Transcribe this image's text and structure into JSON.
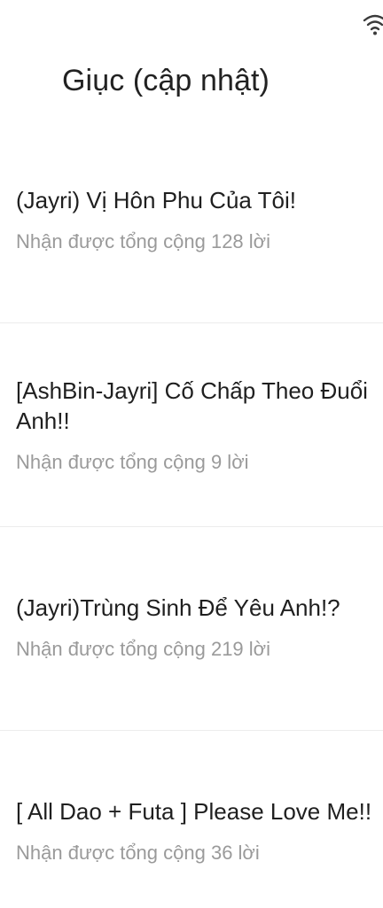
{
  "status_bar": {
    "icons": [
      "wifi-icon"
    ]
  },
  "header": {
    "title": "Giục (cập nhật)"
  },
  "items": [
    {
      "title": "(Jayri) Vị Hôn Phu Của Tôi!",
      "subtitle": "Nhận được tổng cộng 128 lời"
    },
    {
      "title": "[AshBin-Jayri] Cố Chấp Theo Đuổi Anh!!",
      "subtitle": "Nhận được tổng cộng 9 lời"
    },
    {
      "title": "(Jayri)Trùng Sinh Để Yêu Anh!?",
      "subtitle": "Nhận được tổng cộng 219 lời"
    },
    {
      "title": "[ All Dao + Futa ] Please Love Me!!",
      "subtitle": "Nhận được tổng cộng 36 lời"
    }
  ],
  "colors": {
    "title_text": "#222222",
    "subtitle_text": "#9a9a9a",
    "divider": "#ececec",
    "background": "#ffffff"
  }
}
